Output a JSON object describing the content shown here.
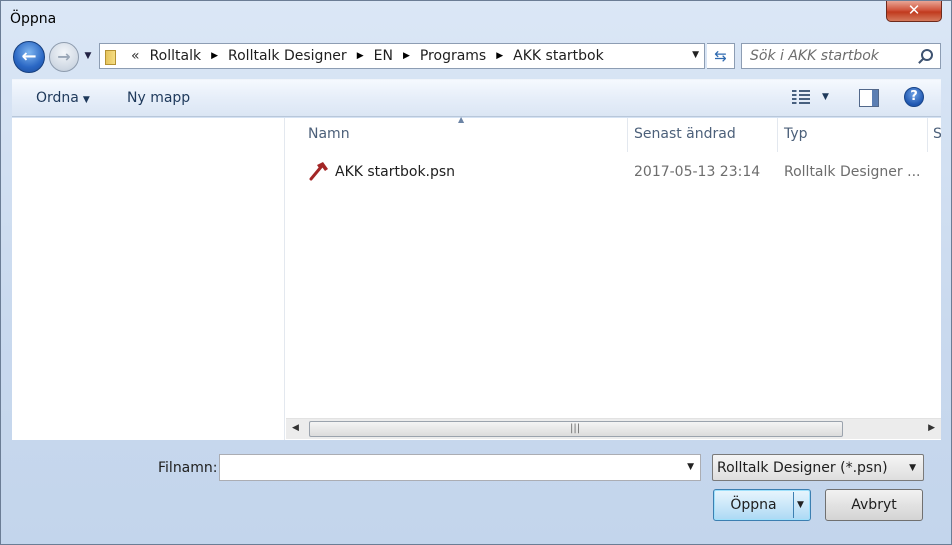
{
  "window": {
    "title": "Öppna",
    "close_label": "✕"
  },
  "nav": {
    "back_label": "←",
    "forward_label": "→",
    "breadcrumb_prefix": "«",
    "breadcrumbs": [
      "Rolltalk",
      "Rolltalk Designer",
      "EN",
      "Programs",
      "AKK startbok"
    ],
    "search_placeholder": "Sök i AKK startbok"
  },
  "toolbar": {
    "organize_label": "Ordna",
    "new_folder_label": "Ny mapp",
    "help_label": "?"
  },
  "columns": [
    "Namn",
    "Senast ändrad",
    "Typ",
    "St"
  ],
  "files": [
    {
      "name": "AKK startbok.psn",
      "modified": "2017-05-13 23:14",
      "type": "Rolltalk Designer ..."
    }
  ],
  "bottom": {
    "filename_label": "Filnamn:",
    "filename_value": "",
    "filter_value": "Rolltalk Designer (*.psn)",
    "open_label": "Öppna",
    "cancel_label": "Avbryt"
  },
  "colors": {
    "accent": "#3c7fb1",
    "file_icon": "#a32626"
  },
  "icons": [
    "back-icon",
    "forward-icon",
    "folder-icon",
    "refresh-icon",
    "search-icon",
    "view-icon",
    "preview-pane-icon",
    "help-icon",
    "rolltalk-file-icon"
  ]
}
